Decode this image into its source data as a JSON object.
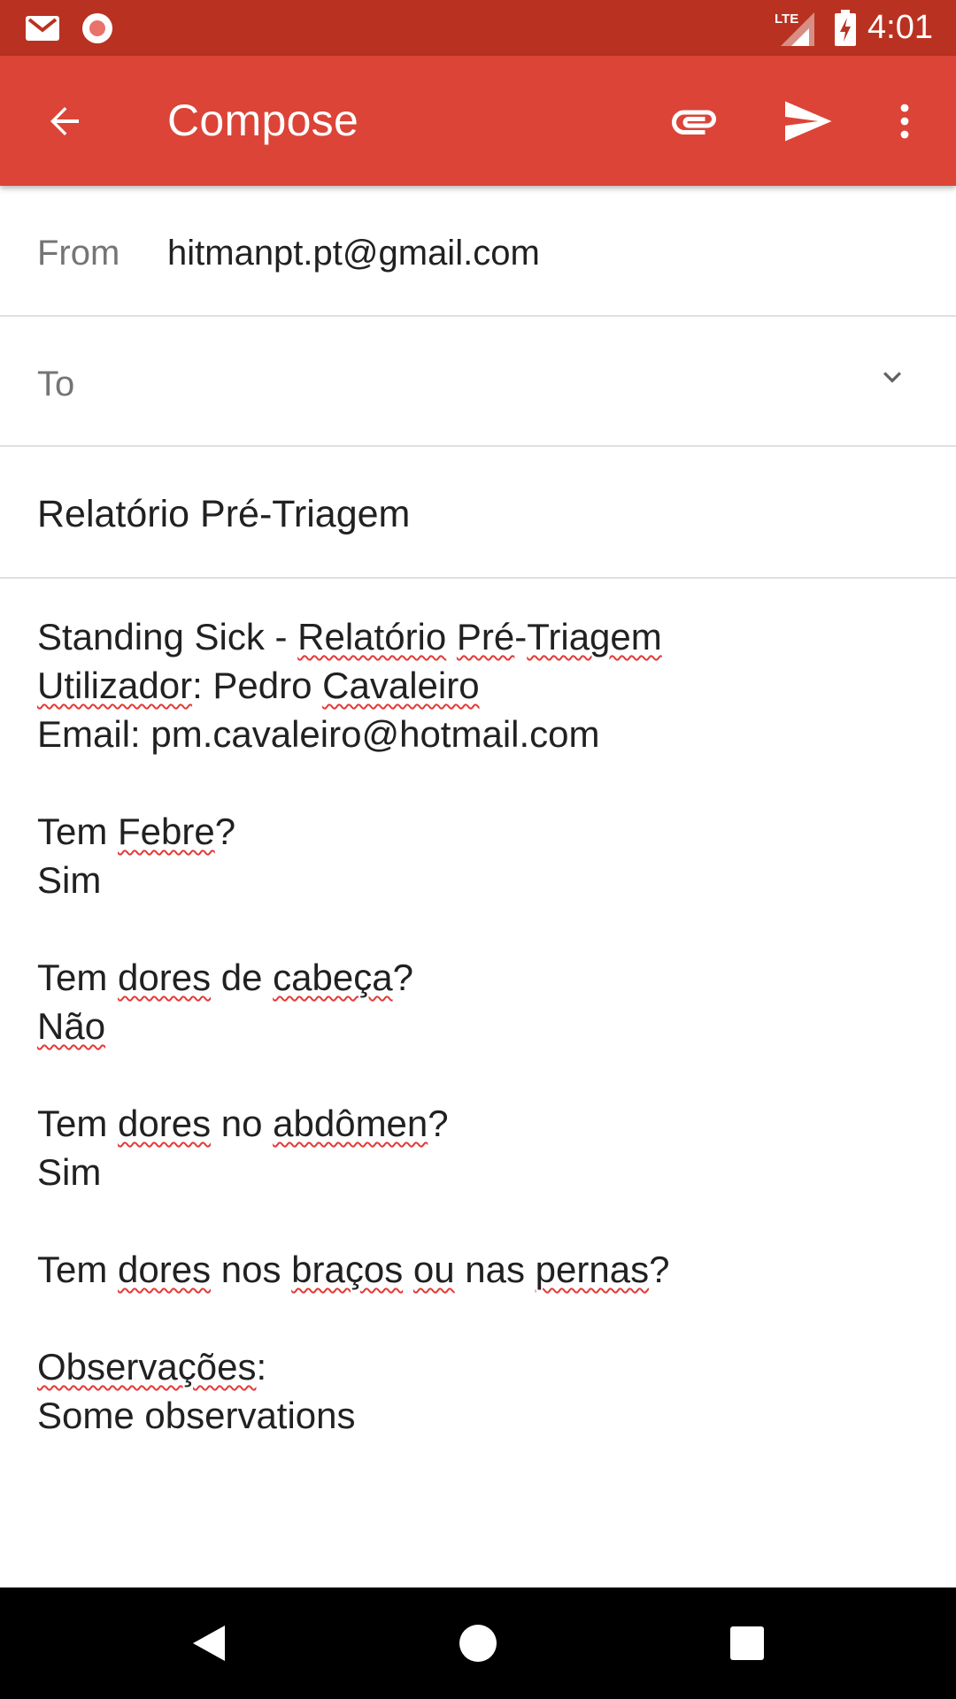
{
  "status_bar": {
    "time": "4:01",
    "network_label": "LTE",
    "icons": [
      "gmail-icon",
      "record-icon",
      "lte-signal-icon",
      "battery-charging-icon"
    ],
    "color": "#b93221"
  },
  "toolbar": {
    "title": "Compose",
    "back_icon": "arrow-back-icon",
    "attach_icon": "paperclip-icon",
    "send_icon": "send-icon",
    "more_icon": "more-vert-icon",
    "color": "#db4437"
  },
  "form": {
    "from_label": "From",
    "from_value": "hitmanpt.pt@gmail.com",
    "to_label": "To",
    "to_value": "",
    "subject": "Relatório Pré-Triagem"
  },
  "body": {
    "lines": [
      [
        {
          "t": "Standing Sick - "
        },
        {
          "t": "Relatório",
          "s": true
        },
        {
          "t": " "
        },
        {
          "t": "Pré",
          "s": true
        },
        {
          "t": "-"
        },
        {
          "t": "Triagem",
          "s": true
        }
      ],
      [
        {
          "t": "Utilizador",
          "s": true
        },
        {
          "t": ": Pedro "
        },
        {
          "t": "Cavaleiro",
          "s": true
        }
      ],
      [
        {
          "t": "Email: pm.cavaleiro@hotmail.com"
        }
      ],
      [],
      [
        {
          "t": "Tem "
        },
        {
          "t": "Febre",
          "s": true
        },
        {
          "t": "?"
        }
      ],
      [
        {
          "t": "Sim"
        }
      ],
      [],
      [
        {
          "t": "Tem "
        },
        {
          "t": "dores",
          "s": true
        },
        {
          "t": " de "
        },
        {
          "t": "cabeça",
          "s": true
        },
        {
          "t": "?"
        }
      ],
      [
        {
          "t": "Não",
          "s": true
        }
      ],
      [],
      [
        {
          "t": "Tem "
        },
        {
          "t": "dores",
          "s": true
        },
        {
          "t": " no "
        },
        {
          "t": "abdômen",
          "s": true
        },
        {
          "t": "?"
        }
      ],
      [
        {
          "t": "Sim"
        }
      ],
      [],
      [
        {
          "t": "Tem "
        },
        {
          "t": "dores",
          "s": true
        },
        {
          "t": " nos "
        },
        {
          "t": "braços",
          "s": true
        },
        {
          "t": " "
        },
        {
          "t": "ou",
          "s": true
        },
        {
          "t": " nas "
        },
        {
          "t": "pernas",
          "s": true
        },
        {
          "t": "?"
        }
      ],
      [],
      [
        {
          "t": "Observações",
          "s": true
        },
        {
          "t": ":"
        }
      ],
      [
        {
          "t": "Some observations"
        }
      ]
    ]
  },
  "nav_bar": {
    "icons": [
      "back-triangle-icon",
      "home-circle-icon",
      "recents-square-icon"
    ]
  }
}
